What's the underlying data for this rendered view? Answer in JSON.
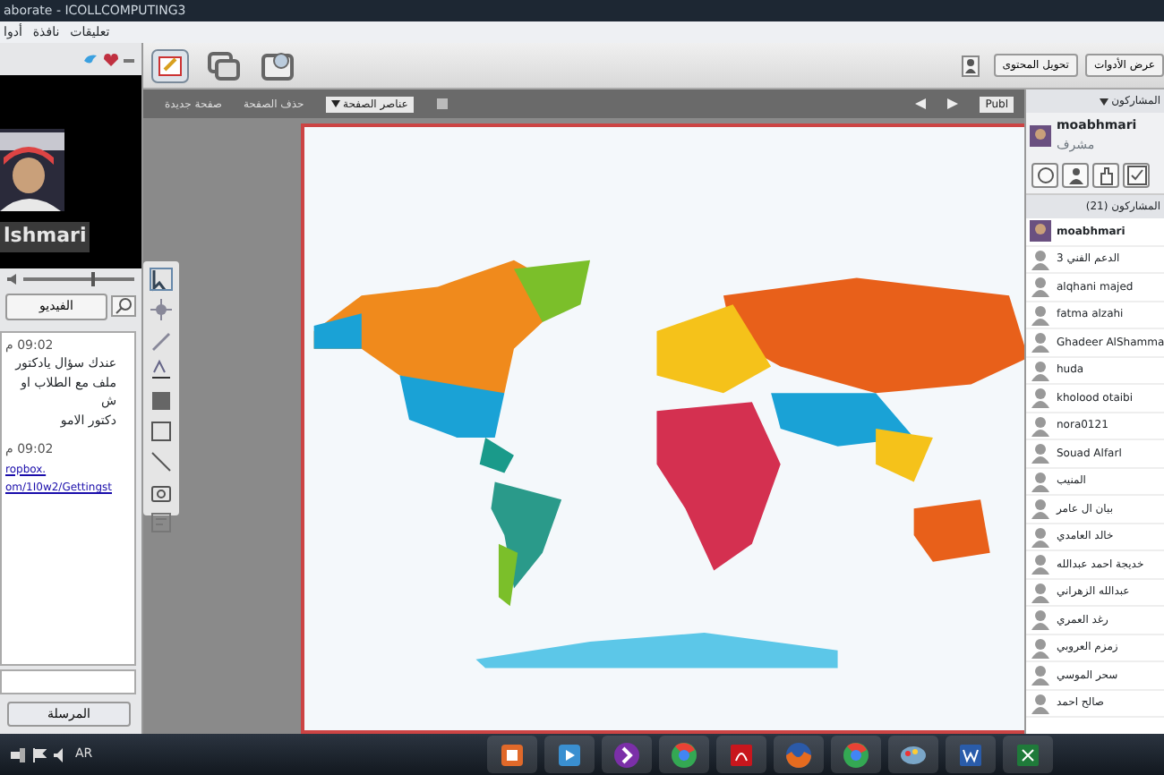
{
  "window": {
    "title": "aborate - ICOLLCOMPUTING3"
  },
  "menu": [
    "تعليقات",
    "نافذة",
    "أدوا"
  ],
  "video": {
    "name_label": "lshmari",
    "button": "الفيديو",
    "volume": {
      "level": 0.62
    }
  },
  "chat": {
    "messages": [
      {
        "time": "09:02 م",
        "lines": [
          "عندك سؤال يادكتور",
          "ملف مع الطلاب او ش",
          "دكتور الامو"
        ],
        "kind": "text"
      },
      {
        "time": "09:02 م",
        "lines": [
          "ropbox.",
          "om/1I0w2/Gettingst"
        ],
        "kind": "link"
      }
    ],
    "send_button": "المرسلة"
  },
  "toolbar": {
    "right_buttons": [
      "عرض الأدوات",
      "تحويل المحتوى"
    ]
  },
  "whiteboard": {
    "actions": [
      "حذف الصفحة",
      "صفحة جديدة"
    ],
    "dropdown": "عناصر الصفحة",
    "page_field": "Publ"
  },
  "participants": {
    "header": "المشاركون",
    "me": {
      "name": "moabhmari",
      "role": "مشرف"
    },
    "list_header": "المشاركون (21)",
    "items": [
      {
        "name": "moabhmari"
      },
      {
        "name": "الدعم الفني 3",
        "kind": "generic"
      },
      {
        "name": "alqhani majed",
        "kind": "generic"
      },
      {
        "name": "fatma alzahi",
        "kind": "generic"
      },
      {
        "name": "Ghadeer AlShamma",
        "kind": "generic"
      },
      {
        "name": "huda",
        "kind": "generic"
      },
      {
        "name": "kholood otaibi",
        "kind": "generic"
      },
      {
        "name": "nora0121",
        "kind": "generic"
      },
      {
        "name": "Souad Alfarl",
        "kind": "generic"
      },
      {
        "name": "المنيب",
        "kind": "generic"
      },
      {
        "name": "بيان ال عامر",
        "kind": "generic"
      },
      {
        "name": "خالد العامدي",
        "kind": "generic"
      },
      {
        "name": "خديجة احمد عبدالله",
        "kind": "generic"
      },
      {
        "name": "عبدالله الزهراني",
        "kind": "generic"
      },
      {
        "name": "رغد العمري",
        "kind": "generic"
      },
      {
        "name": "زمزم العروبي",
        "kind": "generic"
      },
      {
        "name": "سحر الموسي",
        "kind": "generic"
      },
      {
        "name": "صالح احمد",
        "kind": "generic"
      }
    ]
  },
  "taskbar": {
    "language": "AR",
    "apps": [
      {
        "kind": "slides",
        "color": "#e0692a"
      },
      {
        "kind": "media",
        "color": "#3a8fd0"
      },
      {
        "kind": "notes",
        "color": "#7b2fa8"
      },
      {
        "kind": "browser",
        "color": "#34a853"
      },
      {
        "kind": "pdf",
        "color": "#c8161d"
      },
      {
        "kind": "fox",
        "color": "#e56b1f"
      },
      {
        "kind": "browser",
        "color": "#34a853"
      },
      {
        "kind": "paint",
        "color": "#7aa6c8"
      },
      {
        "kind": "doc",
        "color": "#2a5caa"
      },
      {
        "kind": "sheet",
        "color": "#1f7a3a"
      }
    ]
  }
}
